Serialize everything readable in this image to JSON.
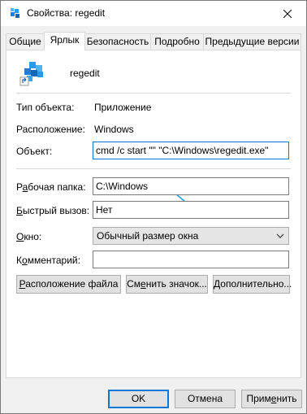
{
  "window": {
    "title": "Свойства: regedit",
    "icon": "regedit-icon",
    "close_icon": "close-icon"
  },
  "tabs": [
    {
      "label": "Общие",
      "active": false
    },
    {
      "label": "Ярлык",
      "active": true
    },
    {
      "label": "Безопасность",
      "active": false
    },
    {
      "label": "Подробно",
      "active": false
    },
    {
      "label": "Предыдущие версии",
      "active": false
    }
  ],
  "shortcut": {
    "name": "regedit",
    "type_label": "Тип объекта:",
    "type_value": "Приложение",
    "location_label": "Расположение:",
    "location_value": "Windows",
    "target_label": "Объект:",
    "target_value": "cmd /c start \"\" \"C:\\Windows\\regedit.exe\"",
    "start_in_label_prefix": "Р",
    "start_in_label_u": "а",
    "start_in_label_rest": "бочая папка:",
    "start_in_value": "C:\\Windows",
    "hotkey_label_prefix": "",
    "hotkey_label_u": "Б",
    "hotkey_label_rest": "ыстрый вызов:",
    "hotkey_value": "Нет",
    "run_label_prefix": "",
    "run_label_u": "О",
    "run_label_rest": "кно:",
    "run_value": "Обычный размер окна",
    "comment_label_prefix": "К",
    "comment_label_u": "о",
    "comment_label_rest": "мментарий:",
    "comment_value": ""
  },
  "actions": {
    "open_location_u": "Р",
    "open_location_rest": "асположение файла",
    "change_icon_prefix": "См",
    "change_icon_u": "е",
    "change_icon_rest": "нить значок...",
    "advanced_prefix": "",
    "advanced_u": "Д",
    "advanced_rest": "ополнительно..."
  },
  "footer": {
    "ok": "OK",
    "cancel": "Отмена",
    "apply_prefix": "Прим",
    "apply_u": "е",
    "apply_rest": "нить"
  },
  "colors": {
    "accent": "#0078d7",
    "arrow": "#1e9fd8"
  }
}
